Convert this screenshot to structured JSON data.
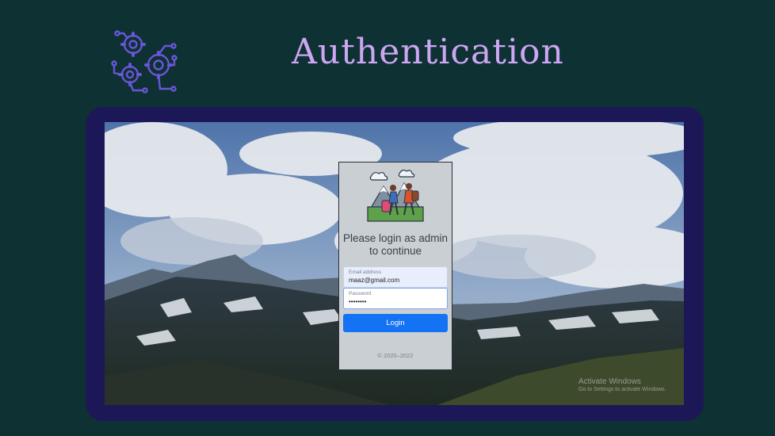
{
  "slide": {
    "title": "Authentication",
    "logo_icon": "gears-circuit-icon",
    "accent_color": "#cda6f2",
    "frame_color": "#1c1858",
    "background_color": "#0e3134"
  },
  "login": {
    "heading": "Please login as admin to continue",
    "illustration_icon": "hikers-mountain-illustration",
    "email_label": "Email address",
    "email_value": "maaz@gmail.com",
    "password_label": "Password",
    "password_value": "••••••••",
    "button_label": "Login",
    "button_color": "#1473f4",
    "copyright": "© 2020–2022"
  },
  "os_watermark": {
    "line1": "Activate Windows",
    "line2": "Go to Settings to activate Windows."
  }
}
